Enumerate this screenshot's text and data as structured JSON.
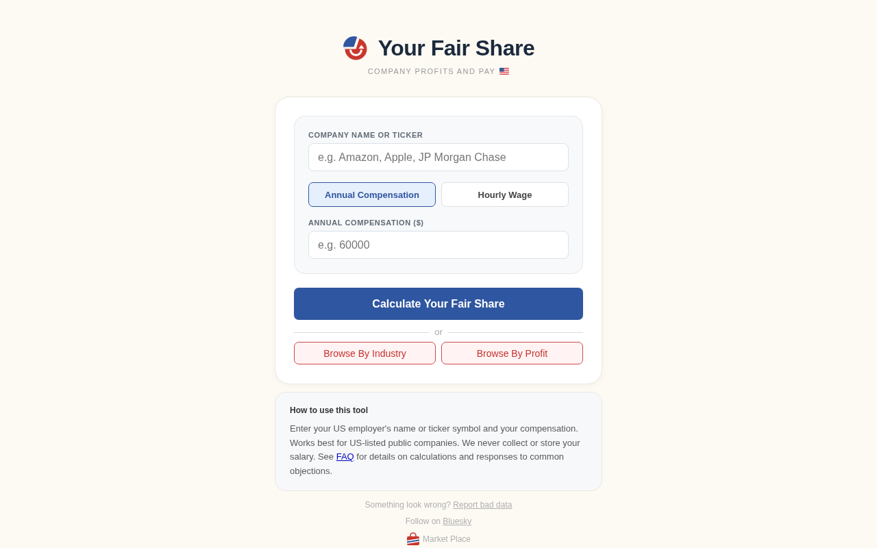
{
  "header": {
    "title": "Your Fair Share",
    "subtitle": "COMPANY PROFITS AND PAY"
  },
  "form": {
    "company": {
      "label": "COMPANY NAME OR TICKER",
      "placeholder": "e.g. Amazon, Apple, JP Morgan Chase"
    },
    "pay_modes": [
      {
        "label": "Annual Compensation",
        "selected": true
      },
      {
        "label": "Hourly Wage",
        "selected": false
      }
    ],
    "amount": {
      "label": "ANNUAL COMPENSATION ($)",
      "placeholder": "e.g. 60000"
    },
    "submit": "Calculate Your Fair Share",
    "divider": "or",
    "browse_buttons": [
      "Browse By Industry",
      "Browse By Profit"
    ]
  },
  "help": {
    "title": "How to use this tool",
    "text_before": "Enter your US employer's name or ticker symbol and your compensation. Works best for US-listed public companies. We never collect or store your salary. See ",
    "link": "FAQ",
    "text_after": " for details on calculations and responses to common objections."
  },
  "footer": {
    "report": {
      "text": "Something look wrong?",
      "link": "Report bad data"
    },
    "follow": {
      "text": "Follow on",
      "link": "Bluesky"
    },
    "marketplace": {
      "label": "Market Place"
    }
  }
}
